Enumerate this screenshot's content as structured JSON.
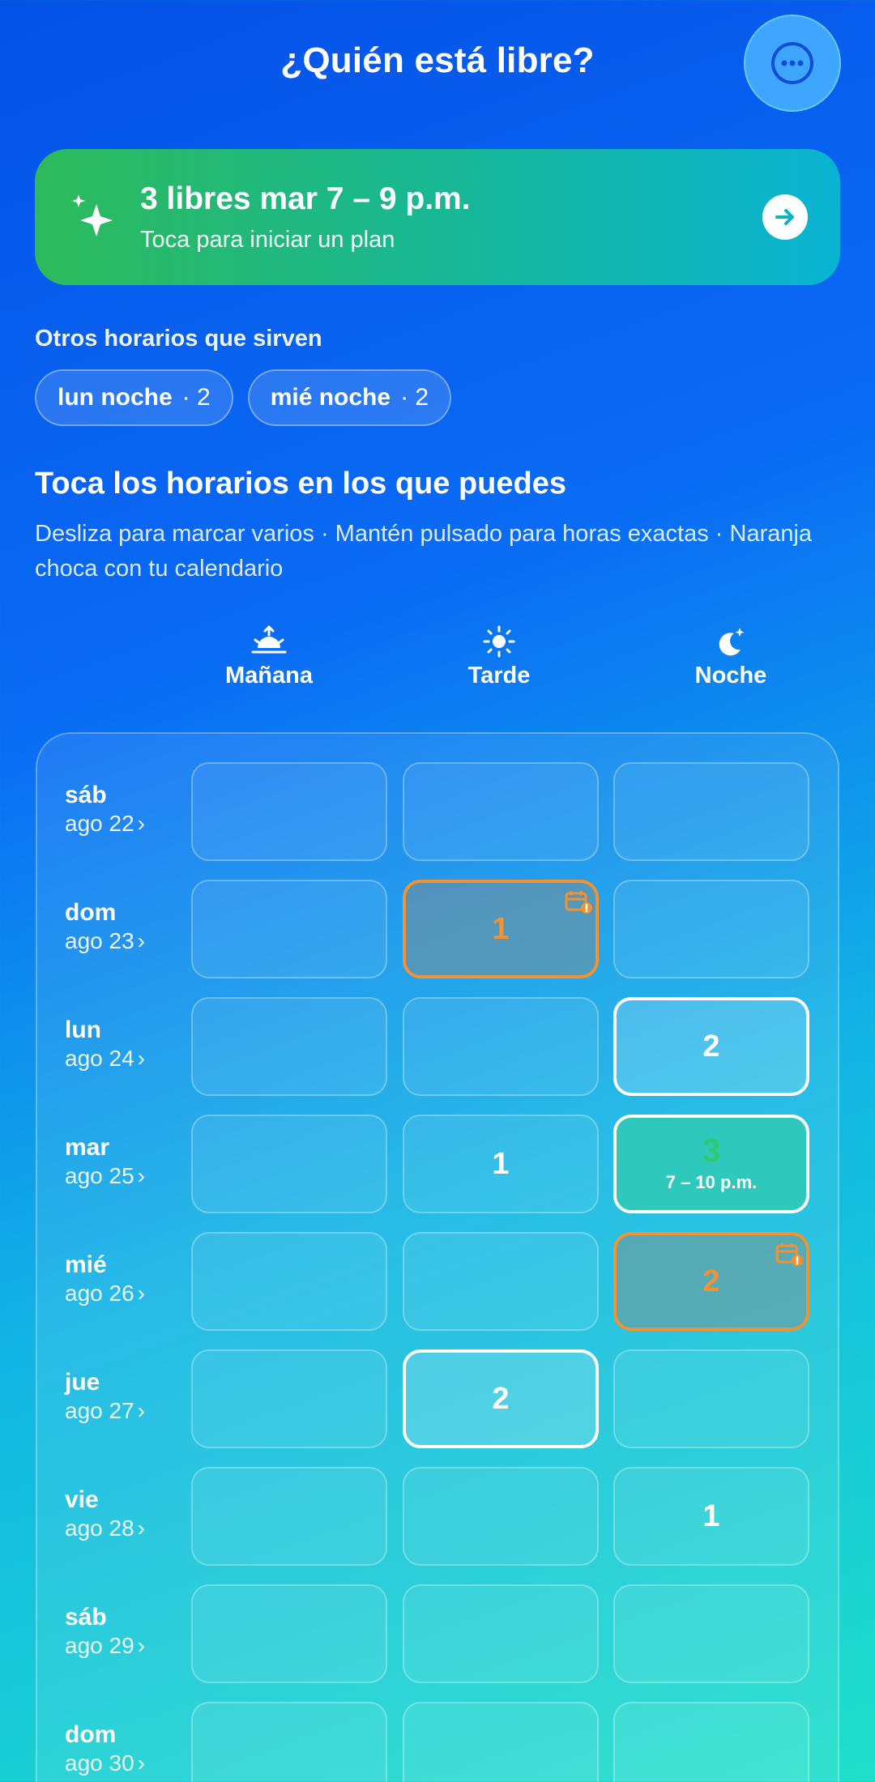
{
  "header": {
    "title": "¿Quién está libre?"
  },
  "banner": {
    "title": "3 libres mar 7 – 9 p.m.",
    "subtitle": "Toca para iniciar un plan"
  },
  "others": {
    "label": "Otros horarios que sirven",
    "chips": [
      {
        "label": "lun noche",
        "count": "· 2"
      },
      {
        "label": "mié noche",
        "count": "· 2"
      }
    ]
  },
  "instructions": {
    "heading": "Toca los horarios en los que puedes",
    "hint": "Desliza para marcar varios · Mantén pulsado para horas exactas · Naranja choca con tu calendario"
  },
  "periods": [
    "Mañana",
    "Tarde",
    "Noche"
  ],
  "days": [
    {
      "name": "sáb",
      "date": "ago 22",
      "cells": [
        {
          "v": ""
        },
        {
          "v": ""
        },
        {
          "v": ""
        }
      ]
    },
    {
      "name": "dom",
      "date": "ago 23",
      "cells": [
        {
          "v": ""
        },
        {
          "v": "1",
          "state": "conflict"
        },
        {
          "v": ""
        }
      ]
    },
    {
      "name": "lun",
      "date": "ago 24",
      "cells": [
        {
          "v": ""
        },
        {
          "v": ""
        },
        {
          "v": "2",
          "state": "sel"
        }
      ]
    },
    {
      "name": "mar",
      "date": "ago 25",
      "cells": [
        {
          "v": ""
        },
        {
          "v": "1"
        },
        {
          "v": "3",
          "state": "best",
          "range": "7 – 10 p.m."
        }
      ]
    },
    {
      "name": "mié",
      "date": "ago 26",
      "cells": [
        {
          "v": ""
        },
        {
          "v": ""
        },
        {
          "v": "2",
          "state": "conflict"
        }
      ]
    },
    {
      "name": "jue",
      "date": "ago 27",
      "cells": [
        {
          "v": ""
        },
        {
          "v": "2",
          "state": "sel"
        },
        {
          "v": ""
        }
      ]
    },
    {
      "name": "vie",
      "date": "ago 28",
      "cells": [
        {
          "v": ""
        },
        {
          "v": ""
        },
        {
          "v": "1"
        }
      ]
    },
    {
      "name": "sáb",
      "date": "ago 29",
      "cells": [
        {
          "v": ""
        },
        {
          "v": ""
        },
        {
          "v": ""
        }
      ]
    },
    {
      "name": "dom",
      "date": "ago 30",
      "cells": [
        {
          "v": ""
        },
        {
          "v": ""
        },
        {
          "v": ""
        }
      ]
    }
  ],
  "icons": {
    "more": "more-horizontal-icon",
    "sparkle": "sparkles-icon",
    "arrow": "arrow-right-icon",
    "morning": "sunrise-icon",
    "afternoon": "sun-icon",
    "night": "moon-icon",
    "calendar": "calendar-conflict-icon"
  },
  "colors": {
    "conflict": "#f29233",
    "best": "#2ecb6b",
    "accent": "#3fa6ff"
  }
}
